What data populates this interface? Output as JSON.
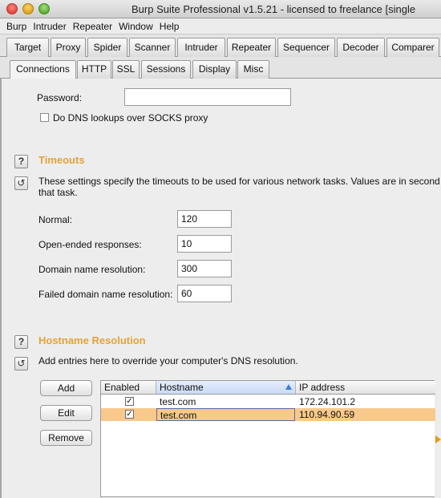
{
  "window": {
    "title": "Burp Suite Professional v1.5.21 - licensed to freelance [single"
  },
  "menubar": [
    "Burp",
    "Intruder",
    "Repeater",
    "Window",
    "Help"
  ],
  "main_tabs": [
    "Target",
    "Proxy",
    "Spider",
    "Scanner",
    "Intruder",
    "Repeater",
    "Sequencer",
    "Decoder",
    "Comparer"
  ],
  "sub_tabs": [
    "Connections",
    "HTTP",
    "SSL",
    "Sessions",
    "Display",
    "Misc"
  ],
  "socks": {
    "password_label": "Password:",
    "password_value": "",
    "dns_checkbox_label": "Do DNS lookups over SOCKS proxy"
  },
  "timeouts": {
    "title": "Timeouts",
    "description_line1": "These settings specify the timeouts to be used for various network tasks. Values are in second",
    "description_line2": "that task.",
    "fields": [
      {
        "label": "Normal:",
        "value": "120"
      },
      {
        "label": "Open-ended responses:",
        "value": "10"
      },
      {
        "label": "Domain name resolution:",
        "value": "300"
      },
      {
        "label": "Failed domain name resolution:",
        "value": "60"
      }
    ]
  },
  "hostname": {
    "title": "Hostname Resolution",
    "description": "Add entries here to override your computer's DNS resolution.",
    "buttons": [
      "Add",
      "Edit",
      "Remove"
    ],
    "columns": [
      "Enabled",
      "Hostname",
      "IP address"
    ],
    "rows": [
      {
        "enabled": "✓",
        "hostname": "test.com",
        "ip": "172.24.101.2"
      },
      {
        "enabled": "✓",
        "hostname": "test.com",
        "ip": "110.94.90.59"
      }
    ]
  },
  "colors": {
    "section_title": "#e5a336",
    "selected_row": "#f9c98c"
  }
}
